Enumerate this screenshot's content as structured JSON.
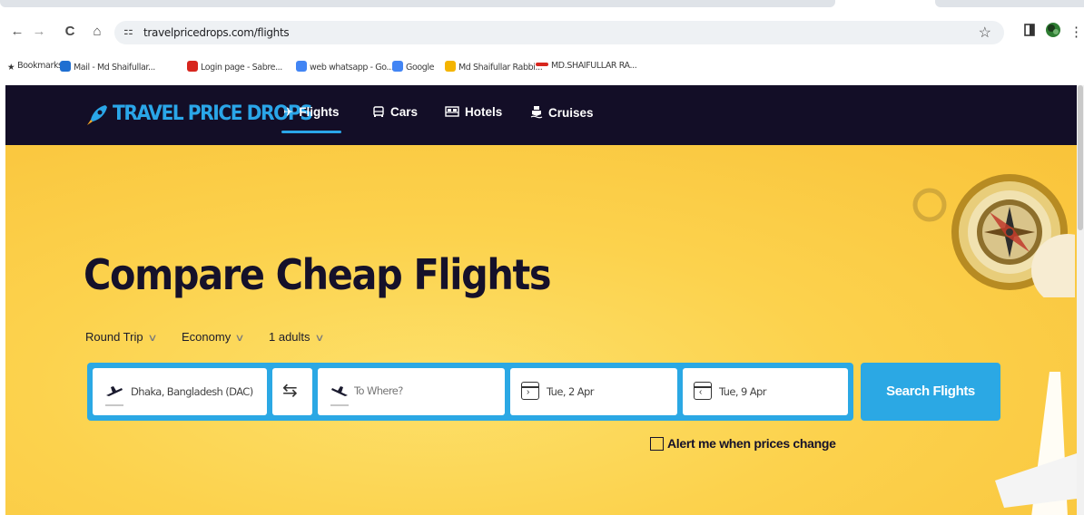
{
  "browser": {
    "url": "travelpricedrops.com/flights",
    "back": "←",
    "forward": "→",
    "reload": "C",
    "home": "⌂",
    "tune": "⚏",
    "star": "☆",
    "menu": "⋮"
  },
  "bookmarks": [
    {
      "label": "Bookmarks",
      "icon": "star-icon",
      "color": "#333333"
    },
    {
      "label": "Mail - Md Shaifullar...",
      "icon": "outlook-icon",
      "color": "#1f6fd1"
    },
    {
      "label": "Login page - Sabre...",
      "icon": "sabre-icon",
      "color": "#d7261e"
    },
    {
      "label": "web whatsapp - Go...",
      "icon": "google-icon",
      "color": "#4285f4"
    },
    {
      "label": "Google",
      "icon": "google-icon",
      "color": "#4285f4"
    },
    {
      "label": "Md Shaifullar Rabbi...",
      "icon": "drive-icon",
      "color": "#f4b400"
    },
    {
      "label": "MD.SHAIFULLAR RA...",
      "icon": "bookmark-icon",
      "color": "#d7261e"
    }
  ],
  "site": {
    "brand": "TRAVEL PRICE DROPS",
    "nav": [
      {
        "label": "Flights",
        "icon": "✈",
        "active": true
      },
      {
        "label": "Cars",
        "icon": "🚘",
        "active": false
      },
      {
        "label": "Hotels",
        "icon": "🛏",
        "active": false
      },
      {
        "label": "Cruises",
        "icon": "⛴",
        "active": false
      }
    ]
  },
  "hero": {
    "title": "Compare Cheap Flights",
    "options": {
      "trip": "Round Trip",
      "cabin": "Economy",
      "travelers": "1 adults"
    },
    "search": {
      "from": "Dhaka, Bangladesh (DAC)",
      "to_placeholder": "To Where?",
      "depart": "Tue, 2 Apr",
      "return": "Tue, 9 Apr",
      "button": "Search Flights"
    },
    "alert_label": "Alert me when prices change"
  },
  "colors": {
    "header_bg": "#130e27",
    "brand_blue": "#2aa6e8",
    "hero_yellow": "#fcd24d"
  }
}
